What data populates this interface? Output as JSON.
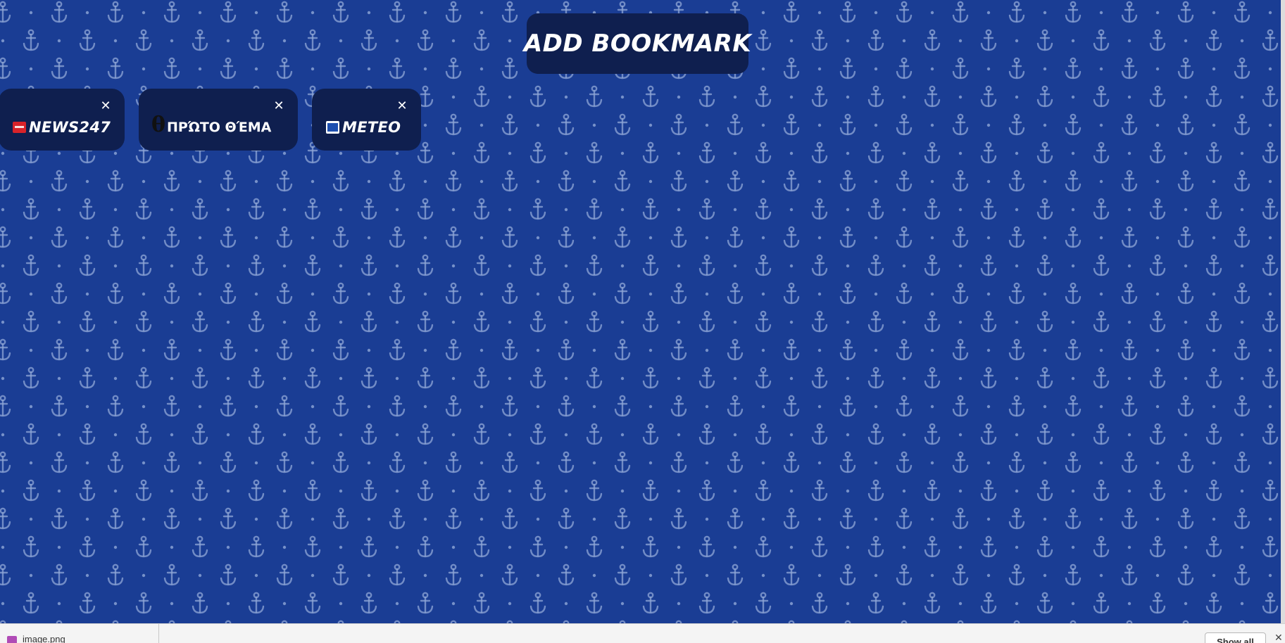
{
  "theme": {
    "background": "#1a3d94",
    "pattern_color": "#8fa6d6",
    "pattern_icon": "anchor-icon",
    "card_background": "#0f1f4f",
    "text_color": "#ffffff"
  },
  "header": {
    "add_bookmark_label": "ADD BOOKMARK"
  },
  "bookmarks": [
    {
      "label": "NEWS247",
      "icon": "news247-favicon",
      "close_icon": "close-icon",
      "close_label": "✕"
    },
    {
      "label": "ΠΡΏΤΟ ΘΈΜΑ",
      "icon": "protothema-theta-favicon",
      "icon_glyph": "θ",
      "close_icon": "close-icon",
      "close_label": "✕"
    },
    {
      "label": "METEO",
      "icon": "meteo-favicon",
      "close_icon": "close-icon",
      "close_label": "✕"
    }
  ],
  "download_bar": {
    "file_name": "image.png",
    "show_all_label": "Show all",
    "close_label": "✕"
  }
}
